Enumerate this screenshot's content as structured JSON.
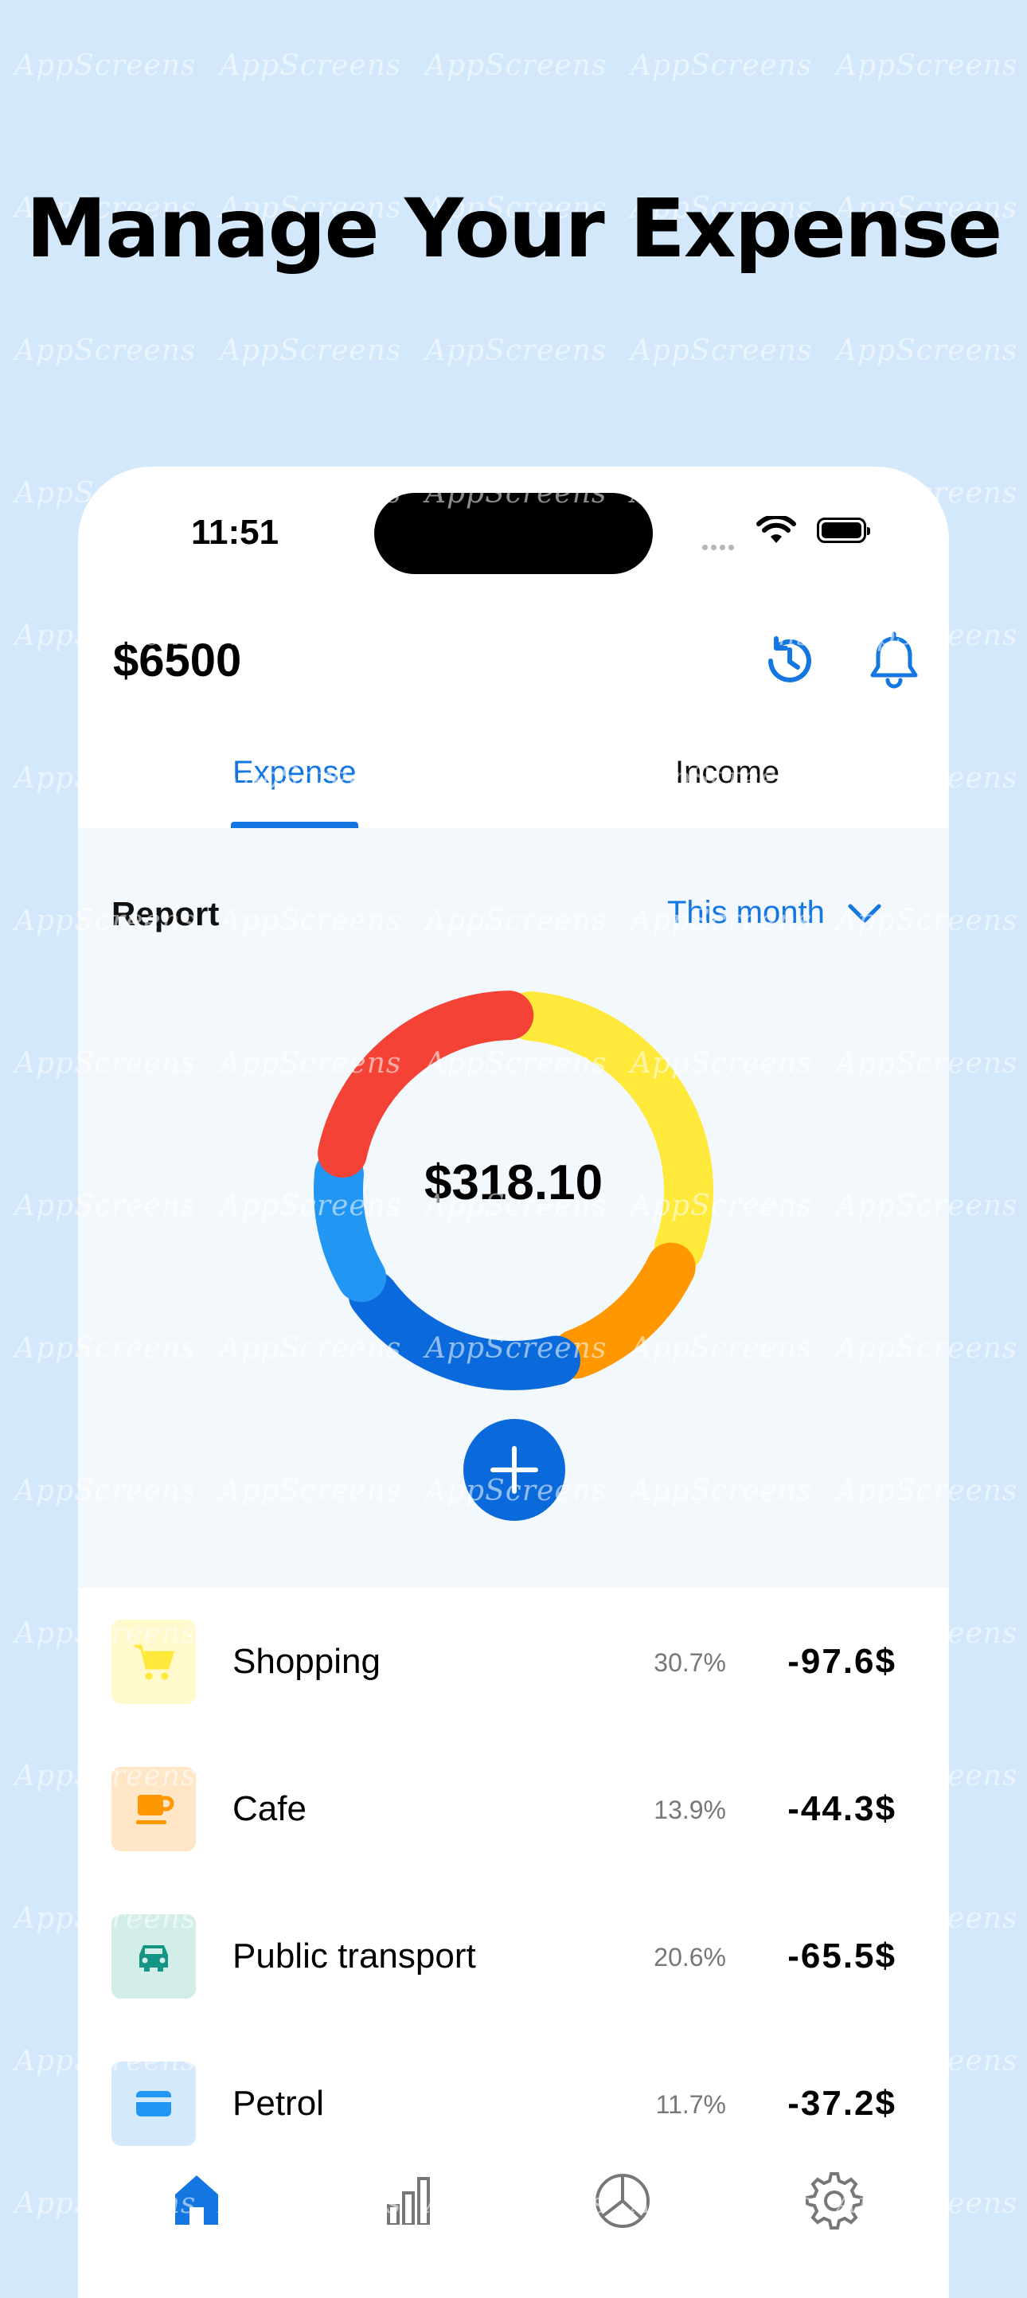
{
  "headline": "Manage Your Expense",
  "watermark": "AppScreens",
  "status_bar": {
    "time": "11:51"
  },
  "header": {
    "balance": "$6500",
    "history_icon": "history-clock-icon",
    "bell_icon": "bell-icon"
  },
  "tabs": [
    {
      "label": "Expense",
      "active": true
    },
    {
      "label": "Income",
      "active": false
    }
  ],
  "report": {
    "title": "Report",
    "period": "This month",
    "total": "$318.10",
    "add_icon": "plus-icon"
  },
  "colors": {
    "accent": "#1476e1",
    "background": "#d3e8fb",
    "shopping": "#ffe93b",
    "cafe": "#ff9800",
    "transport": "#0b6adb",
    "petrol": "#2196f3",
    "other": "#f44336"
  },
  "chart_data": {
    "type": "pie",
    "categories": [
      "Shopping",
      "Cafe",
      "Public transport",
      "Petrol",
      ""
    ],
    "values": [
      30.7,
      13.9,
      20.6,
      11.7,
      23.1
    ],
    "colors": [
      "#ffe93b",
      "#ff9800",
      "#0b6adb",
      "#2196f3",
      "#f44336"
    ]
  },
  "transactions": [
    {
      "name": "Shopping",
      "pct": "30.7%",
      "amount": "-97.6$",
      "icon": "cart-icon",
      "bg": "#fff9cc"
    },
    {
      "name": "Cafe",
      "pct": "13.9%",
      "amount": "-44.3$",
      "icon": "coffee-cup-icon",
      "bg": "#ffe6c7"
    },
    {
      "name": "Public transport",
      "pct": "20.6%",
      "amount": "-65.5$",
      "icon": "car-icon",
      "bg": "#d3eee9"
    },
    {
      "name": "Petrol",
      "pct": "11.7%",
      "amount": "-37.2$",
      "icon": "card-icon",
      "bg": "#d4e9fb"
    }
  ],
  "nav": [
    {
      "icon": "home-icon",
      "active": true
    },
    {
      "icon": "bar-chart-icon",
      "active": false
    },
    {
      "icon": "pie-chart-icon",
      "active": false
    },
    {
      "icon": "settings-gear-icon",
      "active": false
    }
  ]
}
